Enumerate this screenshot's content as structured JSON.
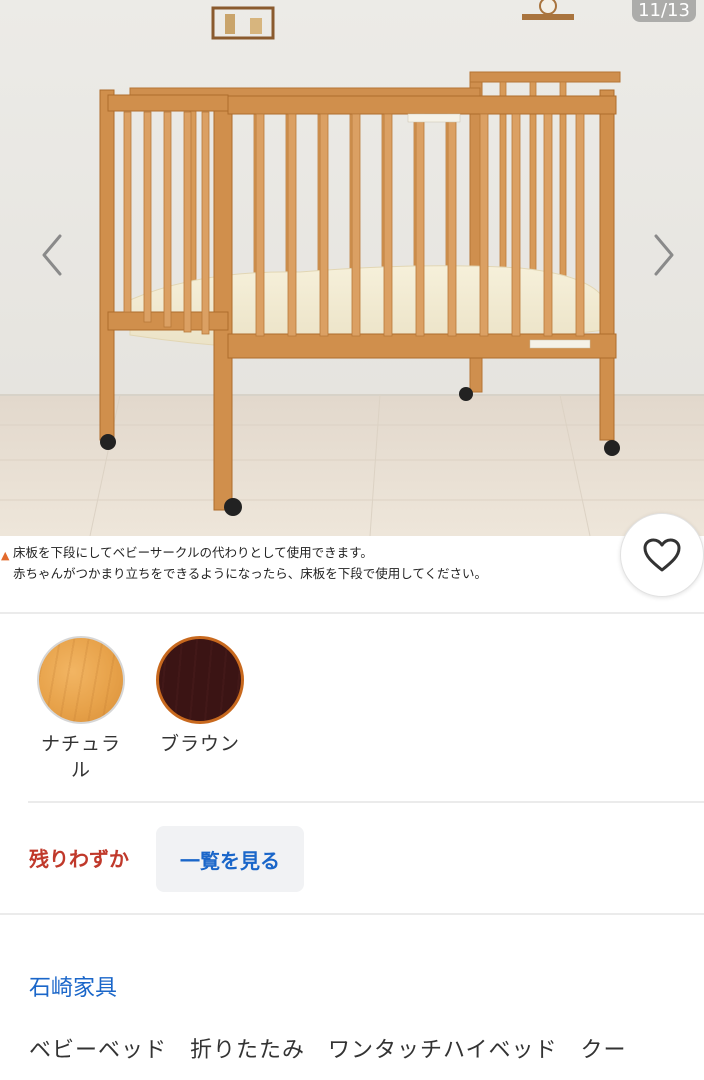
{
  "gallery": {
    "counter": "11/13",
    "caption_line1": "床板を下段にしてベビーサークルの代わりとして使用できます。",
    "caption_line2": "赤ちゃんがつかまり立ちをできるようになったら、床板を下段で使用してください。",
    "warning_icon": "▲",
    "prev_icon": "chevron-left-icon",
    "next_icon": "chevron-right-icon",
    "favorite_icon": "heart-icon"
  },
  "variants": [
    {
      "label": "ナチュラル",
      "color": "#e8a54c"
    },
    {
      "label": "ブラウン",
      "color": "#3b1414"
    }
  ],
  "stock": {
    "status": "残りわずか",
    "status_color": "#c0392b",
    "view_all_label": "一覧を見る"
  },
  "brand": {
    "name": "石崎家具",
    "color": "#1a66c9"
  },
  "product": {
    "title": "ベビーベッド　折りたたみ　ワンタッチハイベッド　クー"
  }
}
